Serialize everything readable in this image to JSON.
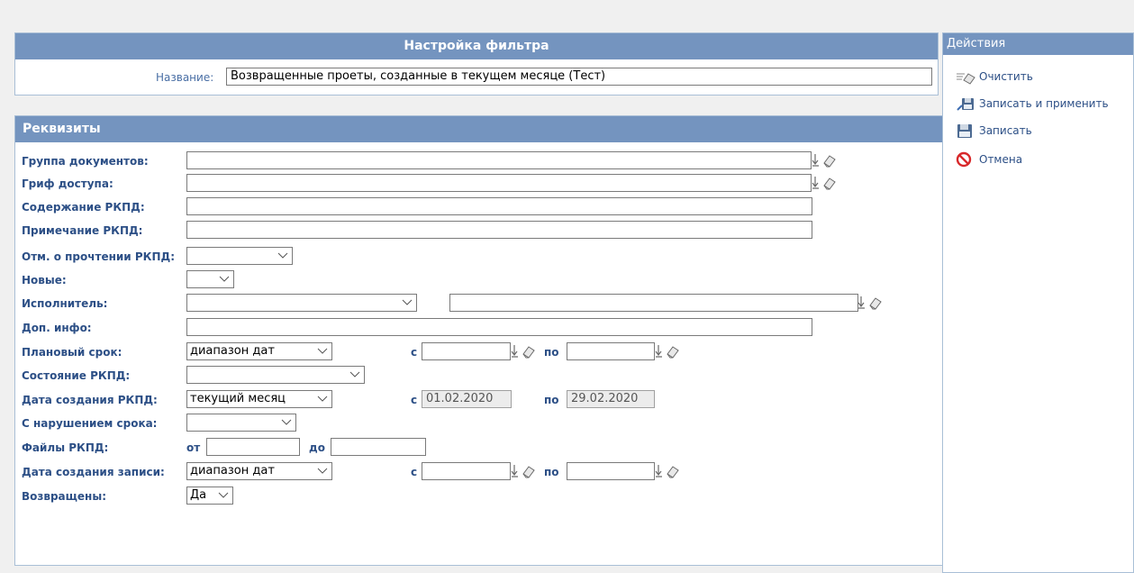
{
  "filter": {
    "title": "Настройка фильтра",
    "name_label": "Название:",
    "name_value": "Возвращенные проеты, созданные в текущем месяце (Тест)"
  },
  "requisites": {
    "title": "Реквизиты",
    "fields": {
      "doc_group": "Группа документов:",
      "access_stamp": "Гриф доступа:",
      "content": "Содержание РКПД:",
      "note": "Примечание РКПД:",
      "read_mark": "Отм. о прочтении РКПД:",
      "new": "Новые:",
      "executor": "Исполнитель:",
      "extra_info": "Доп. инфо:",
      "planned_term": "Плановый срок:",
      "state": "Состояние РКПД:",
      "created_date": "Дата создания РКПД:",
      "overdue": "С нарушением срока:",
      "files": "Файлы РКПД:",
      "record_created": "Дата создания записи:",
      "returned": "Возвращены:"
    },
    "values": {
      "planned_term_mode": "диапазон дат",
      "created_date_mode": "текущий месяц",
      "created_date_from": "01.02.2020",
      "created_date_to": "29.02.2020",
      "record_created_mode": "диапазон дат",
      "returned": "Да"
    },
    "small": {
      "from_c": "с",
      "to_po": "по",
      "from_ot": "от",
      "to_do": "до"
    }
  },
  "actions": {
    "title": "Действия",
    "items": [
      "Очистить",
      "Записать и применить",
      "Записать",
      "Отмена"
    ]
  },
  "icons": {
    "picker": "down-arrow-icon",
    "eraser": "eraser-icon",
    "clear": "clear-icon",
    "save_apply": "disk-pen-icon",
    "save": "disk-icon",
    "cancel": "no-entry-icon"
  },
  "colors": {
    "header": "#7494bf",
    "label": "#2c4f86",
    "cancel": "#d8282a"
  }
}
